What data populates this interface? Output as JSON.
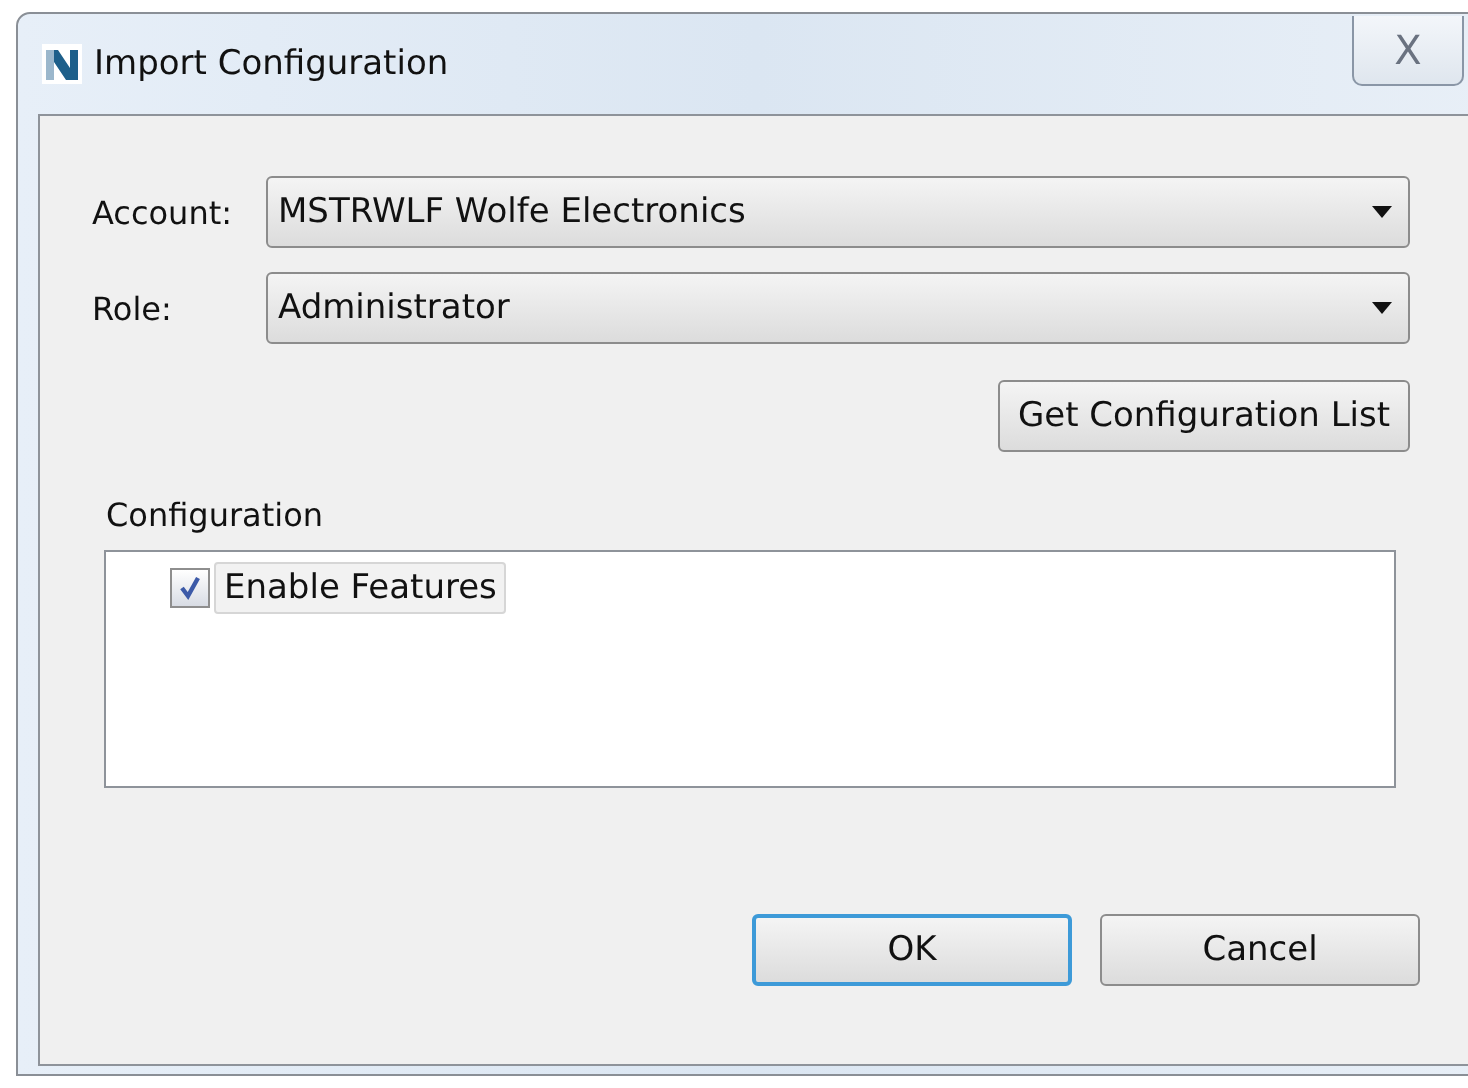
{
  "window": {
    "title": "Import Configuration",
    "close_label": "X"
  },
  "fields": [
    {
      "label": "Account:",
      "value": "MSTRWLF Wolfe Electronics"
    },
    {
      "label": "Role:",
      "value": "Administrator"
    }
  ],
  "get_button": "Get Configuration List",
  "configuration": {
    "label": "Configuration",
    "items": [
      {
        "label": "Enable Features",
        "checked": true,
        "selected": true
      }
    ]
  },
  "buttons": [
    {
      "label": "OK",
      "default": true
    },
    {
      "label": "Cancel",
      "default": false
    }
  ]
}
